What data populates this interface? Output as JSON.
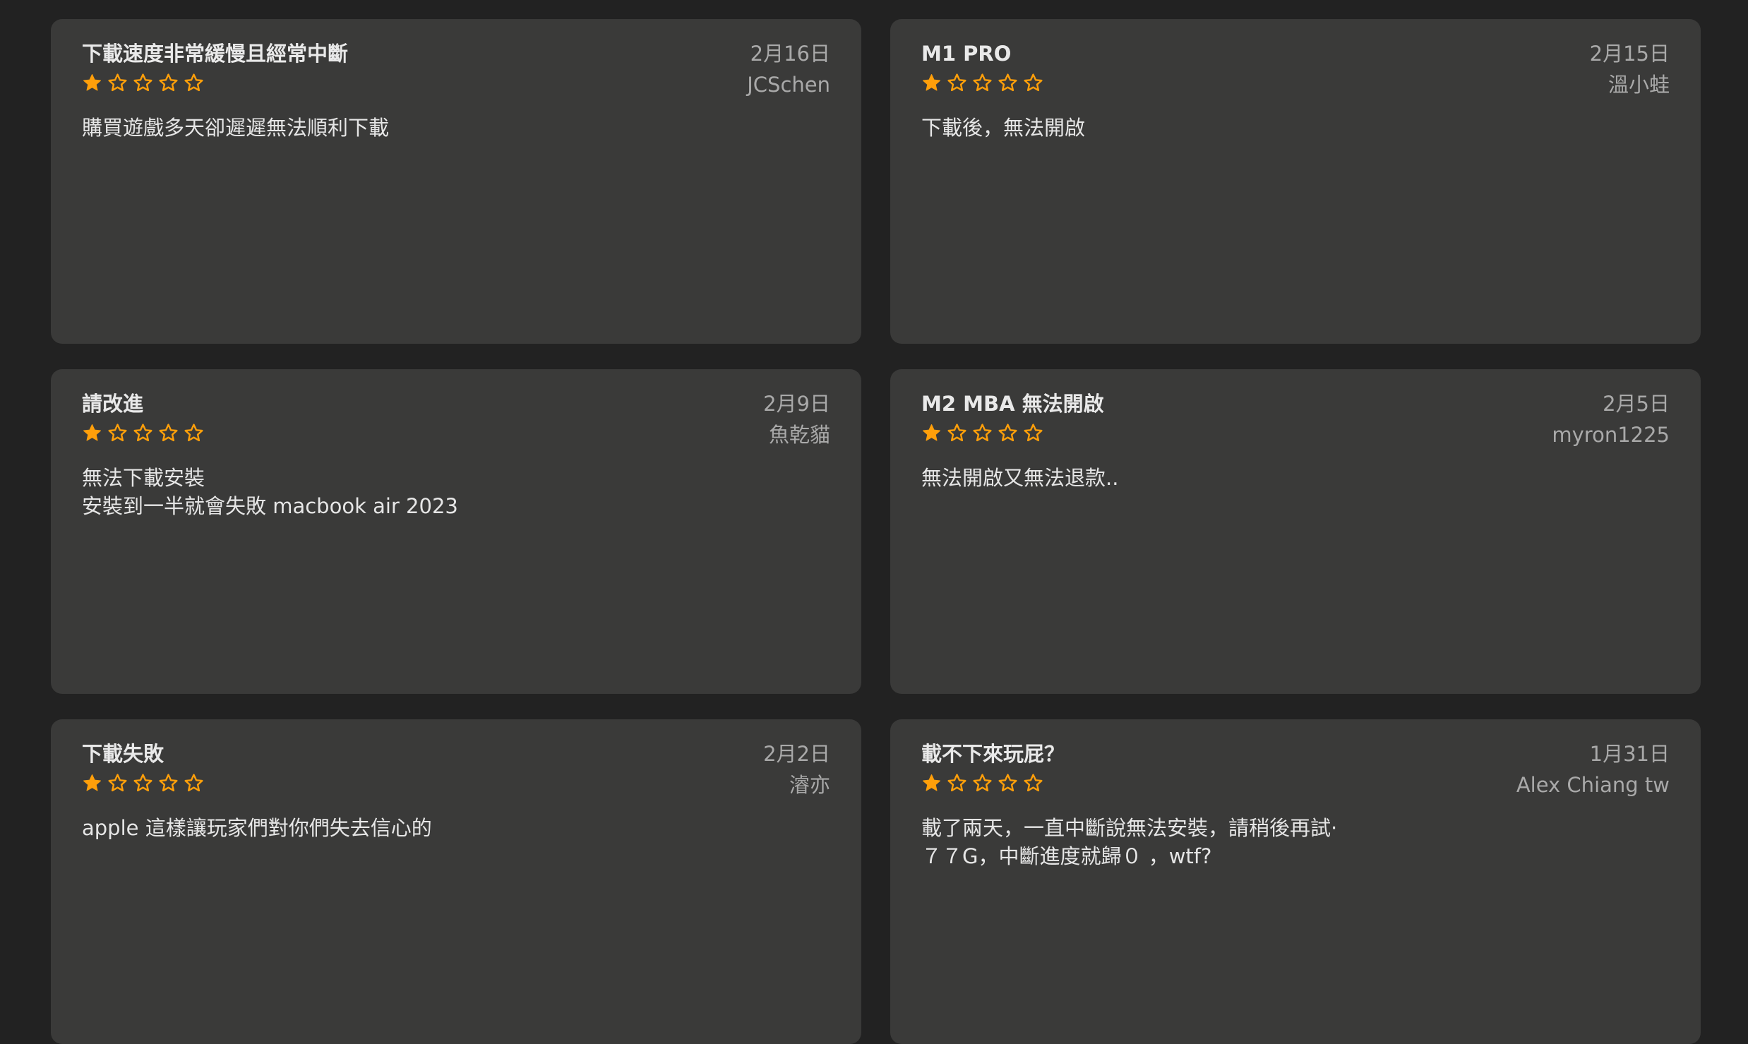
{
  "reviews": [
    {
      "title": "下載速度非常緩慢且經常中斷",
      "date": "2月16日",
      "author": "JCSchen",
      "rating": 1,
      "body": "購買遊戲多天卻遲遲無法順利下載"
    },
    {
      "title": "M1 PRO",
      "date": "2月15日",
      "author": "溫小蛙",
      "rating": 1,
      "body": "下載後，無法開啟"
    },
    {
      "title": "請改進",
      "date": "2月9日",
      "author": "魚乾貓",
      "rating": 1,
      "body": "無法下載安裝\n安裝到一半就會失敗 macbook air 2023"
    },
    {
      "title": "M2 MBA 無法開啟",
      "date": "2月5日",
      "author": "myron1225",
      "rating": 1,
      "body": "無法開啟又無法退款.."
    },
    {
      "title": "下載失敗",
      "date": "2月2日",
      "author": "濬亦",
      "rating": 1,
      "body": "apple 這樣讓玩家們對你們失去信心的"
    },
    {
      "title": "載不下來玩屁？",
      "date": "1月31日",
      "author": "Alex Chiang tw",
      "rating": 1,
      "body": "載了兩天，一直中斷說無法安裝，請稍後再試·\n７７G，中斷進度就歸０ ，wtf?"
    }
  ],
  "star_color": "#ff9f0a",
  "star_icon": "star-icon"
}
